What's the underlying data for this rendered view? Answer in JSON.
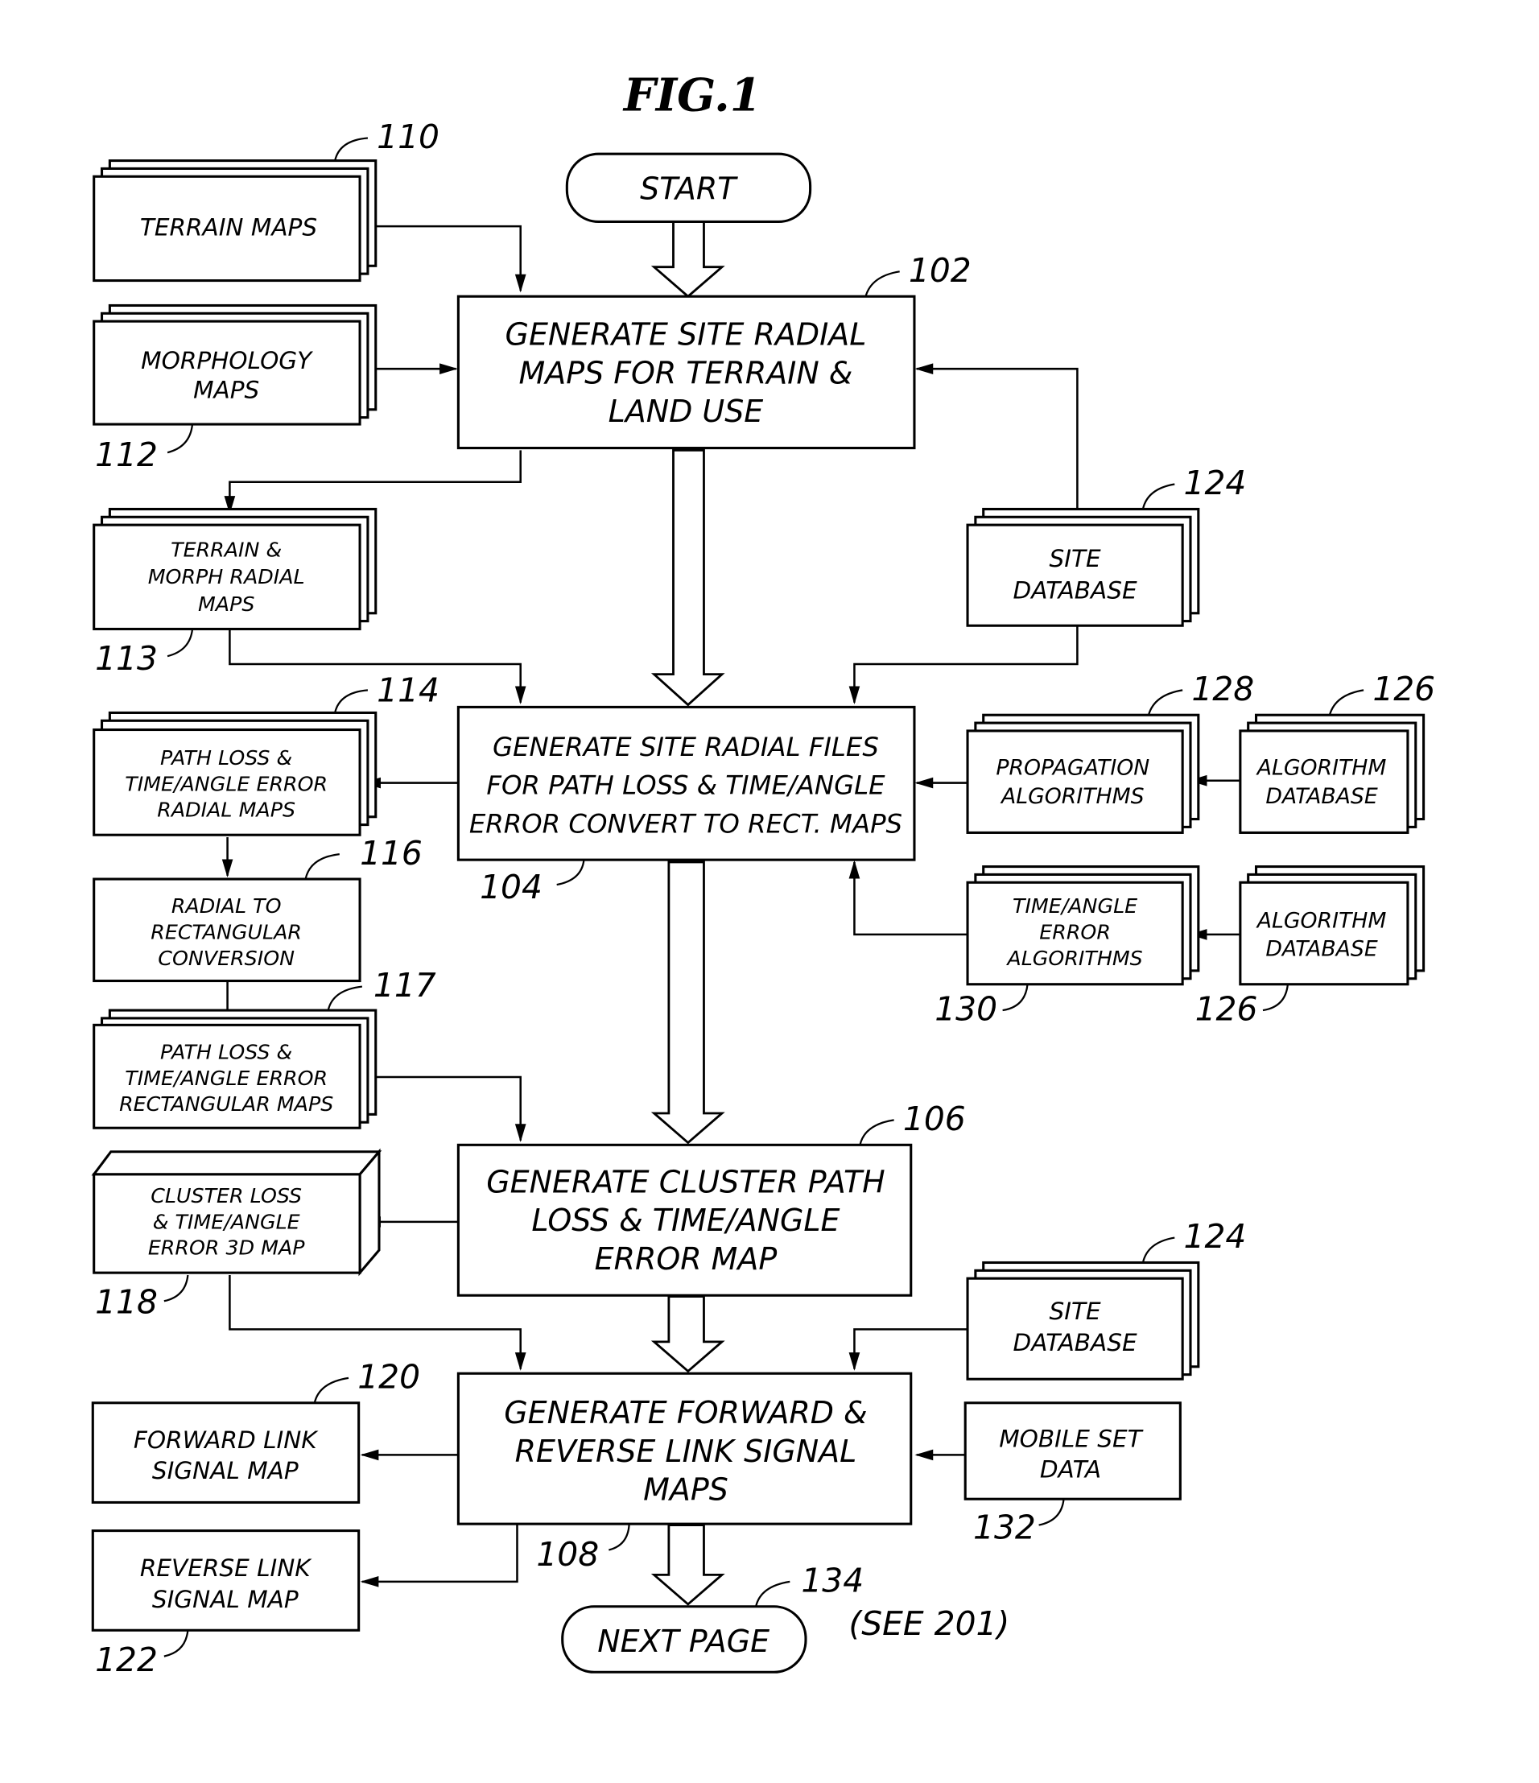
{
  "figure": {
    "title": "FIG.1",
    "page_ref_note": "(SEE 201)"
  },
  "terminals": {
    "start": "START",
    "next_page": "NEXT PAGE"
  },
  "process_steps": [
    {
      "ref": "102",
      "lines": [
        "GENERATE SITE RADIAL",
        "MAPS FOR TERRAIN &",
        "LAND USE"
      ]
    },
    {
      "ref": "104",
      "lines": [
        "GENERATE SITE RADIAL FILES",
        "FOR PATH LOSS & TIME/ANGLE",
        "ERROR CONVERT TO RECT. MAPS"
      ]
    },
    {
      "ref": "106",
      "lines": [
        "GENERATE CLUSTER PATH",
        "LOSS & TIME/ANGLE",
        "ERROR MAP"
      ]
    },
    {
      "ref": "108",
      "lines": [
        "GENERATE FORWARD &",
        "REVERSE LINK SIGNAL",
        "MAPS"
      ]
    }
  ],
  "data_stores": {
    "terrain_maps": {
      "ref": "110",
      "lines": [
        "TERRAIN  MAPS"
      ]
    },
    "morphology_maps": {
      "ref": "112",
      "lines": [
        "MORPHOLOGY",
        "MAPS"
      ]
    },
    "terrain_morph_radial": {
      "ref": "113",
      "lines": [
        "TERRAIN &",
        "MORPH RADIAL",
        "MAPS"
      ]
    },
    "pathloss_radial": {
      "ref": "114",
      "lines": [
        "PATH LOSS &",
        "TIME/ANGLE ERROR",
        "RADIAL MAPS"
      ]
    },
    "radial_to_rect": {
      "ref": "116",
      "lines": [
        "RADIAL TO",
        "RECTANGULAR",
        "CONVERSION"
      ]
    },
    "pathloss_rect": {
      "ref": "117",
      "lines": [
        "PATH LOSS &",
        "TIME/ANGLE ERROR",
        "RECTANGULAR MAPS"
      ]
    },
    "cluster_3d": {
      "ref": "118",
      "lines": [
        "CLUSTER LOSS",
        "& TIME/ANGLE",
        "ERROR 3D MAP"
      ]
    },
    "forward_link": {
      "ref": "120",
      "lines": [
        "FORWARD LINK",
        "SIGNAL MAP"
      ]
    },
    "reverse_link": {
      "ref": "122",
      "lines": [
        "REVERSE LINK",
        "SIGNAL MAP"
      ]
    },
    "site_db_1": {
      "ref": "124",
      "lines": [
        "SITE",
        "DATABASE"
      ]
    },
    "site_db_2": {
      "ref": "124",
      "lines": [
        "SITE",
        "DATABASE"
      ]
    },
    "algo_db_1": {
      "ref": "126",
      "lines": [
        "ALGORITHM",
        "DATABASE"
      ]
    },
    "algo_db_2": {
      "ref": "126",
      "lines": [
        "ALGORITHM",
        "DATABASE"
      ]
    },
    "propagation": {
      "ref": "128",
      "lines": [
        "PROPAGATION",
        "ALGORITHMS"
      ]
    },
    "time_angle_algos": {
      "ref": "130",
      "lines": [
        "TIME/ANGLE",
        "ERROR",
        "ALGORITHMS"
      ]
    },
    "mobile_set": {
      "ref": "132",
      "lines": [
        "MOBILE SET",
        "DATA"
      ]
    }
  },
  "next_page_ref": "134"
}
